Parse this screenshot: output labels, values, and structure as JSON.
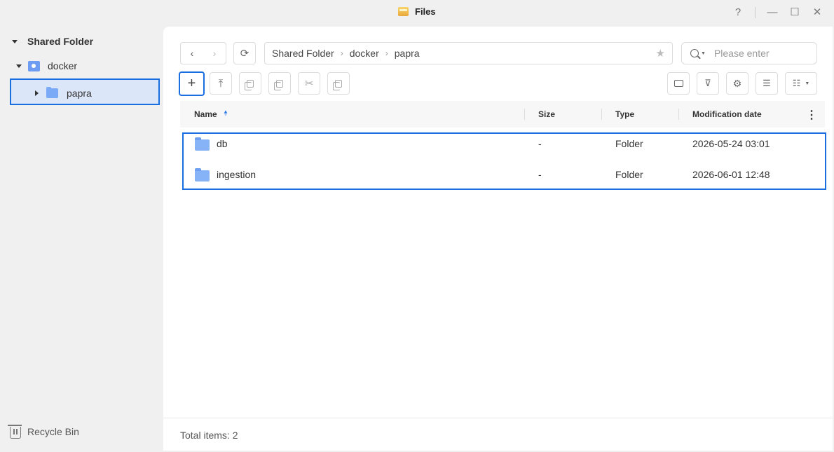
{
  "window": {
    "title": "Files",
    "controls": {
      "help": "?",
      "minimize": "—",
      "maximize": "☐",
      "close": "✕"
    }
  },
  "sidebar": {
    "root": "Shared Folder",
    "docker": "docker",
    "papra": "papra",
    "recycle_bin": "Recycle Bin"
  },
  "toolbar": {
    "back": "‹",
    "forward": "›",
    "refresh": "⟳",
    "new": "+",
    "upload": "⤒",
    "cut": "✂"
  },
  "breadcrumb": {
    "items": [
      "Shared Folder",
      "docker",
      "papra"
    ]
  },
  "search": {
    "placeholder": "Please enter"
  },
  "table": {
    "columns": {
      "name": "Name",
      "size": "Size",
      "type": "Type",
      "modified": "Modification date"
    },
    "sort": {
      "column": "name",
      "direction": "ascending"
    },
    "rows": [
      {
        "name": "db",
        "size": "-",
        "type": "Folder",
        "modified": "2026-05-24 03:01"
      },
      {
        "name": "ingestion",
        "size": "-",
        "type": "Folder",
        "modified": "2026-06-01 12:48"
      }
    ]
  },
  "footer": {
    "total": "Total items: 2"
  },
  "colors": {
    "accent": "#1a6fe0",
    "folder": "#7aaaf5",
    "selection": "#dbe6f8"
  }
}
